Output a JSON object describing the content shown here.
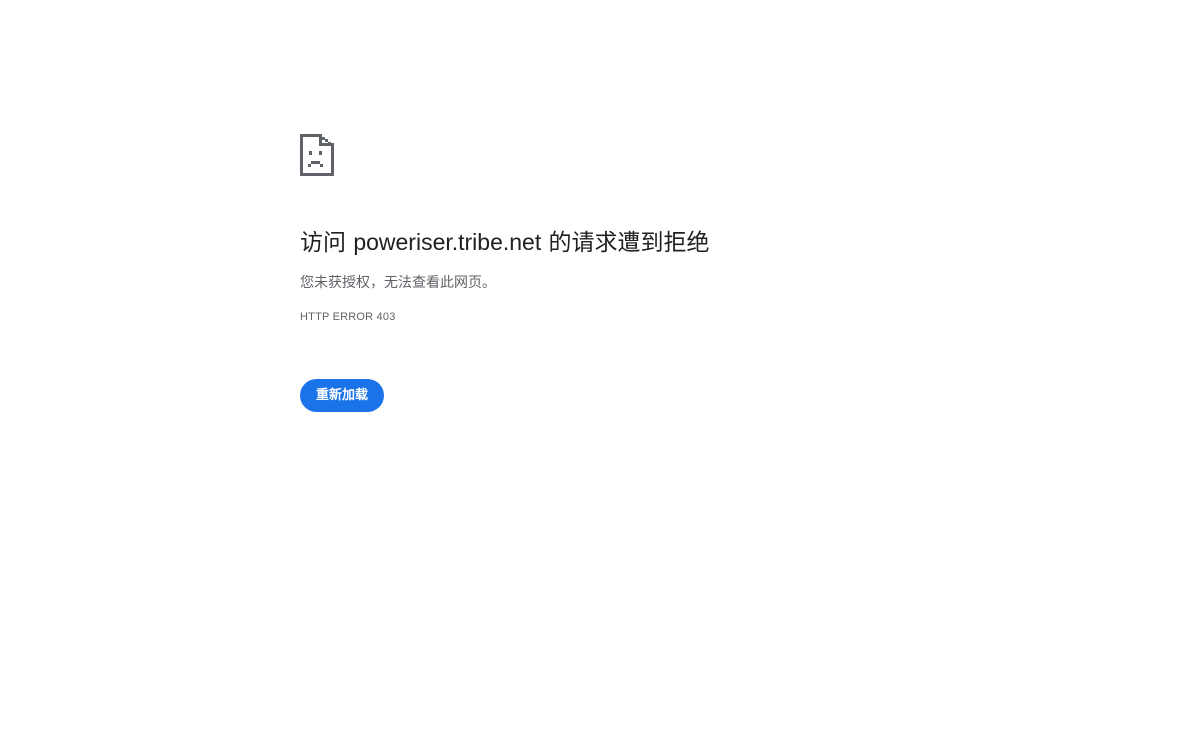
{
  "error_page": {
    "title_prefix": "访问 ",
    "host": "poweriser.tribe.net",
    "title_suffix": " 的请求遭到拒绝",
    "description": "您未获授权，无法查看此网页。",
    "error_code": "HTTP ERROR 403",
    "reload_button_label": "重新加载",
    "icon": "sad-document-icon"
  },
  "colors": {
    "accent": "#1a73e8",
    "title_text": "#202124",
    "secondary_text": "#5f6368",
    "icon": "#5f6368"
  }
}
